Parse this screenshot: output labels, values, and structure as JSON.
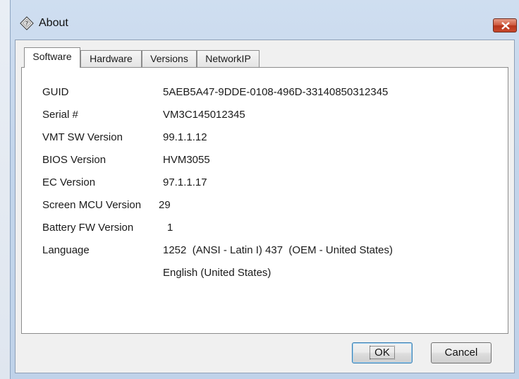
{
  "window": {
    "title": "About"
  },
  "tabs": [
    {
      "label": "Software",
      "active": true
    },
    {
      "label": "Hardware",
      "active": false
    },
    {
      "label": "Versions",
      "active": false
    },
    {
      "label": "NetworkIP",
      "active": false
    }
  ],
  "software": {
    "rows": [
      {
        "label": "GUID",
        "value": "5AEB5A47-9DDE-0108-496D-33140850312345"
      },
      {
        "label": "Serial #",
        "value": "VM3C145012345"
      },
      {
        "label": "VMT SW Version",
        "value": "99.1.1.12"
      },
      {
        "label": "BIOS Version",
        "value": "HVM3055"
      },
      {
        "label": "EC Version",
        "value": "97.1.1.17"
      },
      {
        "label": "Screen MCU Version",
        "value": "29"
      },
      {
        "label": "Battery FW Version",
        "value": "1"
      },
      {
        "label": "Language",
        "value": "1252  (ANSI - Latin I) 437  (OEM - United States)"
      }
    ],
    "language_name": "English (United States)"
  },
  "buttons": {
    "ok": "OK",
    "cancel": "Cancel"
  },
  "icons": {
    "title": "about-diamond-icon",
    "close": "close-icon"
  },
  "colors": {
    "close_button": "#c94a2d",
    "window_frame": "#c3d5eb",
    "default_button_border": "#3c7fb1"
  }
}
